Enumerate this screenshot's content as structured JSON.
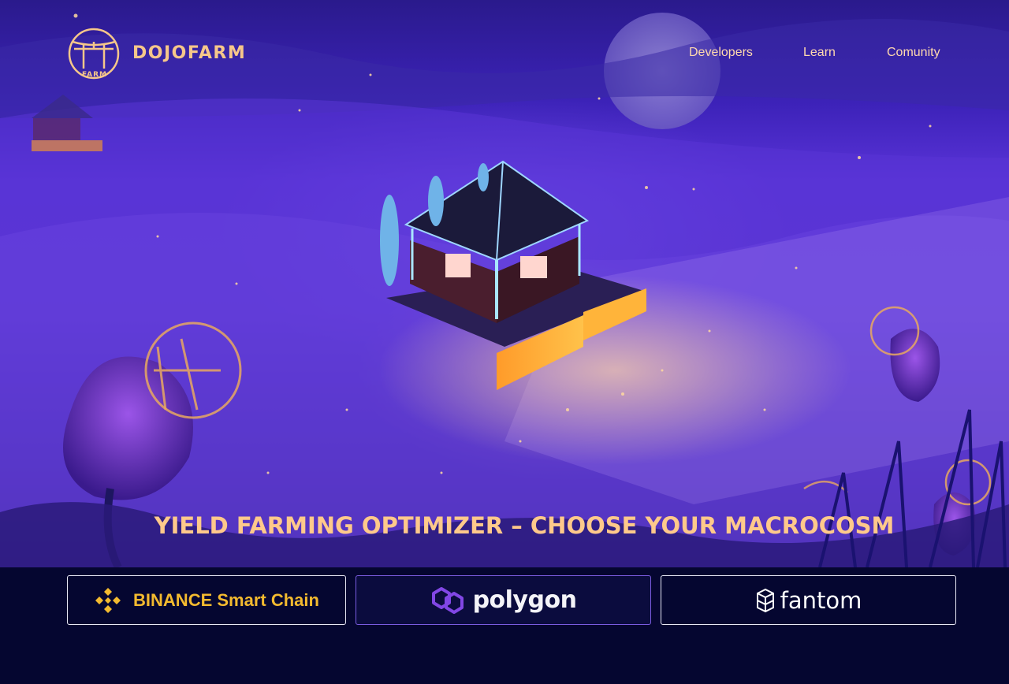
{
  "brand": {
    "name": "DOJOFARM",
    "mark_text": "FARM",
    "accent_color": "#f6c78a"
  },
  "nav": {
    "items": [
      {
        "label": "Developers"
      },
      {
        "label": "Learn"
      },
      {
        "label": "Comunity"
      }
    ]
  },
  "hero": {
    "tagline": "YIELD FARMING OPTIMIZER – CHOOSE YOUR MACROCOSM",
    "illustration": "night-farm-dojo-illustration"
  },
  "chains": [
    {
      "label": "BINANCE Smart Chain",
      "icon": "binance-icon",
      "color": "#f3ba2f",
      "selected": false
    },
    {
      "label": "polygon",
      "icon": "polygon-icon",
      "color": "#8247e5",
      "selected": true
    },
    {
      "label": "fantom",
      "icon": "fantom-icon",
      "color": "#ffffff",
      "selected": false
    }
  ]
}
